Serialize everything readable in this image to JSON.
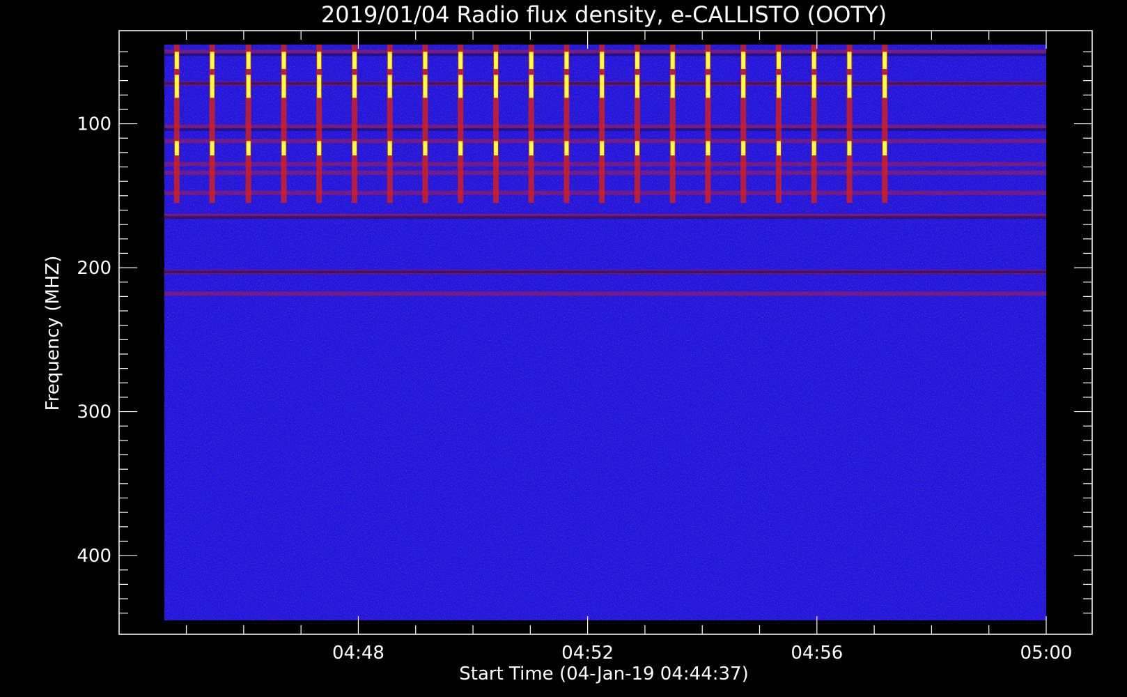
{
  "chart_data": {
    "type": "heatmap",
    "title": "2019/01/04  Radio flux density, e-CALLISTO (OOTY)",
    "xlabel": "Start Time (04-Jan-19 04:44:37)",
    "ylabel": "Frequency (MHZ)",
    "x_range": [
      "04:44:37",
      "05:00:00"
    ],
    "y_range": [
      45,
      445
    ],
    "y_inverted": true,
    "x_ticks": [
      "04:48",
      "04:52",
      "04:56",
      "05:00"
    ],
    "y_ticks": [
      100,
      200,
      300,
      400
    ],
    "colormap": {
      "low": "#1616e6",
      "mid": "#d02020",
      "high": "#ffff40",
      "saturated_low": "#000000"
    },
    "features": {
      "periodic_bursts": {
        "times": [
          "04:44:50",
          "04:45:27",
          "04:46:05",
          "04:46:42",
          "04:47:19",
          "04:47:56",
          "04:48:33",
          "04:49:10",
          "04:49:47",
          "04:50:24",
          "04:51:01",
          "04:51:38",
          "04:52:15",
          "04:52:52",
          "04:53:29",
          "04:54:06",
          "04:54:43",
          "04:55:20",
          "04:55:57",
          "04:56:34",
          "04:57:11"
        ],
        "freq_band": [
          45,
          155
        ]
      },
      "rfi_bands_mhz": [
        50,
        72,
        102,
        112,
        128,
        134,
        148,
        164,
        203,
        218
      ],
      "dark_bands_mhz": [
        52,
        72,
        104,
        165,
        203
      ]
    }
  }
}
